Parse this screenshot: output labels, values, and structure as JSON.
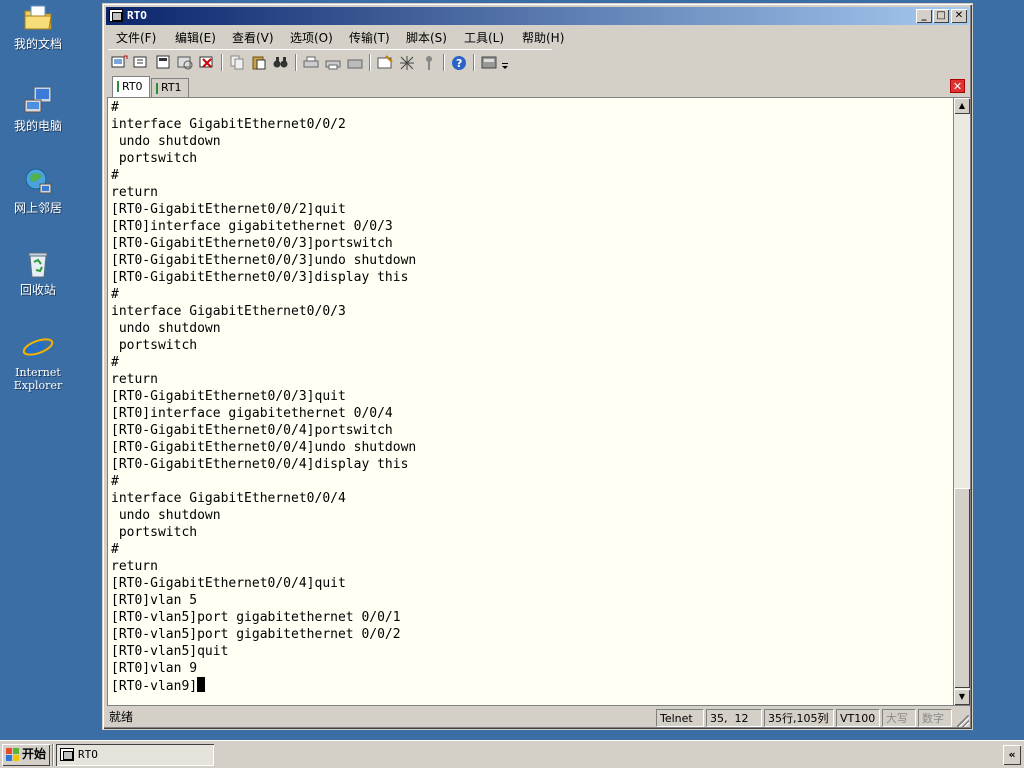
{
  "desktop": {
    "icons": [
      {
        "label": "我的文档",
        "icon": "folder-documents-icon"
      },
      {
        "label": "我的电脑",
        "icon": "computer-icon"
      },
      {
        "label": "网上邻居",
        "icon": "network-icon"
      },
      {
        "label": "回收站",
        "icon": "recycle-bin-icon"
      },
      {
        "label": "Internet\nExplorer",
        "icon": "internet-explorer-icon"
      }
    ]
  },
  "window": {
    "title": "RTO",
    "menu": [
      "文件(F)",
      "编辑(E)",
      "查看(V)",
      "选项(O)",
      "传输(T)",
      "脚本(S)",
      "工具(L)",
      "帮助(H)"
    ],
    "tabs": [
      {
        "label": "RT0",
        "active": true
      },
      {
        "label": "RT1",
        "active": false
      }
    ]
  },
  "terminal": {
    "lines": [
      "#",
      "interface GigabitEthernet0/0/2",
      " undo shutdown",
      " portswitch",
      "#",
      "return",
      "[RT0-GigabitEthernet0/0/2]quit",
      "[RT0]interface gigabitethernet 0/0/3",
      "[RT0-GigabitEthernet0/0/3]portswitch",
      "[RT0-GigabitEthernet0/0/3]undo shutdown",
      "[RT0-GigabitEthernet0/0/3]display this",
      "#",
      "interface GigabitEthernet0/0/3",
      " undo shutdown",
      " portswitch",
      "#",
      "return",
      "[RT0-GigabitEthernet0/0/3]quit",
      "[RT0]interface gigabitethernet 0/0/4",
      "[RT0-GigabitEthernet0/0/4]portswitch",
      "[RT0-GigabitEthernet0/0/4]undo shutdown",
      "[RT0-GigabitEthernet0/0/4]display this",
      "#",
      "interface GigabitEthernet0/0/4",
      " undo shutdown",
      " portswitch",
      "#",
      "return",
      "[RT0-GigabitEthernet0/0/4]quit",
      "[RT0]vlan 5",
      "[RT0-vlan5]port gigabitethernet 0/0/1",
      "[RT0-vlan5]port gigabitethernet 0/0/2",
      "[RT0-vlan5]quit",
      "[RT0]vlan 9",
      "[RT0-vlan9]"
    ]
  },
  "status": {
    "ready": "就绪",
    "protocol": "Telnet",
    "cursor": "35,  12",
    "size": "35行,105列",
    "emulation": "VT100",
    "caps": "大写",
    "num": "数字"
  },
  "taskbar": {
    "start_label": "开始",
    "task_label": "RTO",
    "tray_label": "«"
  }
}
